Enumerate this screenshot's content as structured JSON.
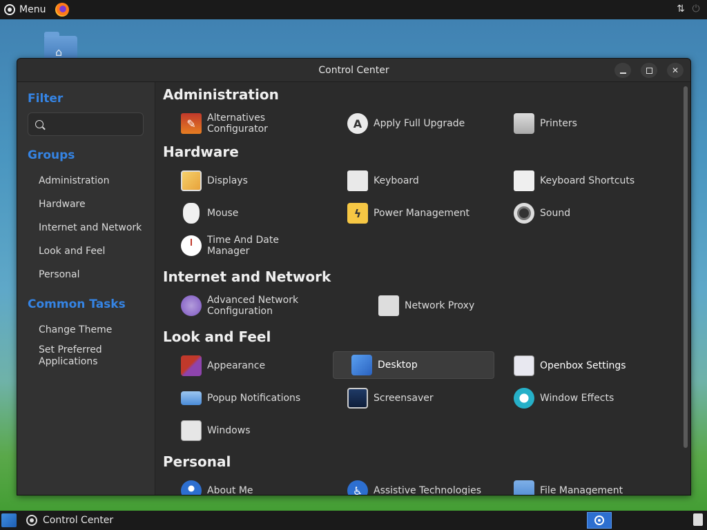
{
  "top_panel": {
    "menu_label": "Menu"
  },
  "window": {
    "title": "Control Center",
    "sidebar": {
      "filter_heading": "Filter",
      "search_placeholder": "",
      "groups_heading": "Groups",
      "groups": [
        "Administration",
        "Hardware",
        "Internet and Network",
        "Look and Feel",
        "Personal"
      ],
      "tasks_heading": "Common Tasks",
      "tasks": [
        "Change Theme",
        "Set Preferred Applications"
      ]
    },
    "sections": [
      {
        "title": "Administration",
        "items": [
          "Alternatives Configurator",
          "Apply Full Upgrade",
          "Printers"
        ]
      },
      {
        "title": "Hardware",
        "items": [
          "Displays",
          "Keyboard",
          "Keyboard Shortcuts",
          "Mouse",
          "Power Management",
          "Sound",
          "Time And Date Manager"
        ]
      },
      {
        "title": "Internet and Network",
        "items": [
          "Advanced Network Configuration",
          "Network Proxy"
        ]
      },
      {
        "title": "Look and Feel",
        "items": [
          "Appearance",
          "Desktop",
          "Openbox Settings",
          "Popup Notifications",
          "Screensaver",
          "Window Effects",
          "Windows"
        ]
      },
      {
        "title": "Personal",
        "items": [
          "About Me",
          "Assistive Technologies",
          "File Management"
        ]
      }
    ],
    "selected_item": "Desktop"
  },
  "bottom_panel": {
    "task_label": "Control Center"
  }
}
